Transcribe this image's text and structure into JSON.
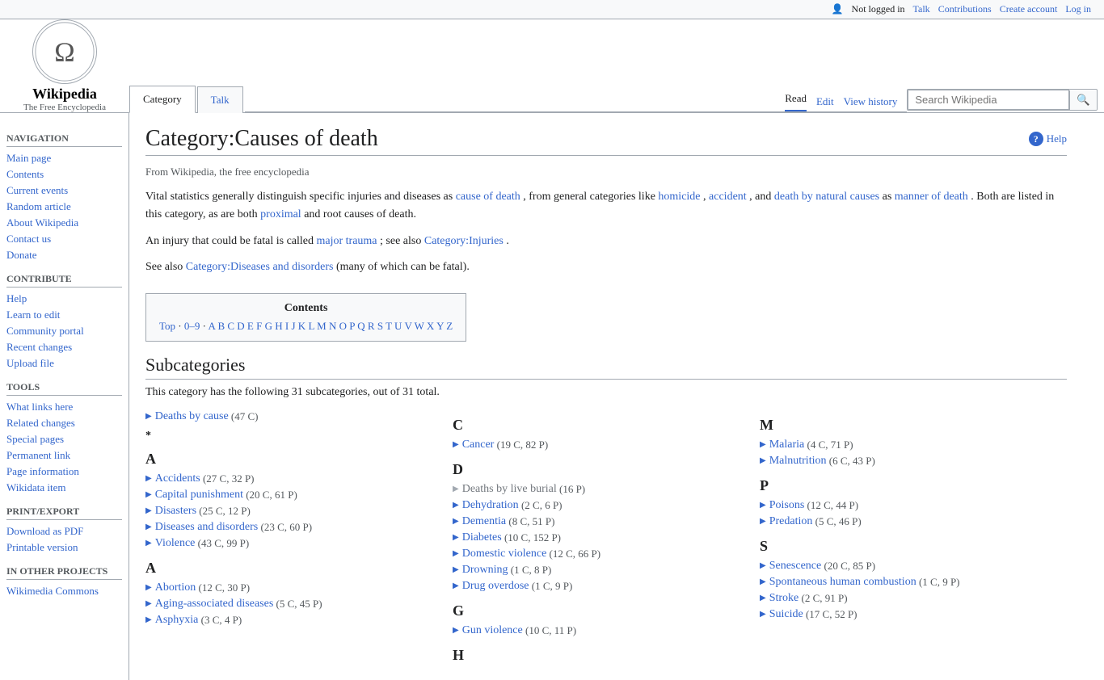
{
  "topbar": {
    "user_icon": "👤",
    "not_logged_in": "Not logged in",
    "talk": "Talk",
    "contributions": "Contributions",
    "create_account": "Create account",
    "log_in": "Log in"
  },
  "logo": {
    "title": "Wikipedia",
    "subtitle": "The Free Encyclopedia"
  },
  "tabs": {
    "category": "Category",
    "talk": "Talk"
  },
  "actions": {
    "read": "Read",
    "edit": "Edit",
    "view_history": "View history"
  },
  "search": {
    "placeholder": "Search Wikipedia"
  },
  "sidebar": {
    "navigation_title": "Navigation",
    "main_page": "Main page",
    "contents": "Contents",
    "current_events": "Current events",
    "random_article": "Random article",
    "about": "About Wikipedia",
    "contact": "Contact us",
    "donate": "Donate",
    "contribute_title": "Contribute",
    "help": "Help",
    "learn_to_edit": "Learn to edit",
    "community_portal": "Community portal",
    "recent_changes": "Recent changes",
    "upload_file": "Upload file",
    "tools_title": "Tools",
    "what_links": "What links here",
    "related_changes": "Related changes",
    "special_pages": "Special pages",
    "permanent_link": "Permanent link",
    "page_information": "Page information",
    "wikidata": "Wikidata item",
    "print_title": "Print/export",
    "download_pdf": "Download as PDF",
    "printable": "Printable version",
    "other_title": "In other projects",
    "wikimedia": "Wikimedia Commons"
  },
  "page": {
    "title": "Category:Causes of death",
    "help": "Help",
    "from_wikipedia": "From Wikipedia, the free encyclopedia",
    "para1_before": "Vital statistics generally distinguish specific injuries and diseases as ",
    "para1_link1": "cause of death",
    "para1_mid1": ", from general categories like ",
    "para1_link2": "homicide",
    "para1_sep1": ", ",
    "para1_link3": "accident",
    "para1_mid2": ", and ",
    "para1_link4": "death by natural causes",
    "para1_mid3": " as ",
    "para1_link5": "manner of death",
    "para1_end": ". Both are listed in this category, as are both ",
    "para1_link6": "proximal",
    "para1_end2": " and root causes of death.",
    "para2_before": "An injury that could be fatal is called ",
    "para2_link1": "major trauma",
    "para2_mid": "; see also ",
    "para2_link2": "Category:Injuries",
    "para2_end": ".",
    "para3_before": "See also ",
    "para3_link1": "Category:Diseases and disorders",
    "para3_end": " (many of which can be fatal).",
    "contents_title": "Contents",
    "contents_links": "Top · 0–9 · A B C D E F G H I J K L M N O P Q R S T U V W X Y Z",
    "subcategories_title": "Subcategories",
    "subcategory_desc": "This category has the following 31 subcategories, out of 31 total."
  },
  "col1": {
    "items": [
      {
        "letter": "",
        "name": "Deaths by cause",
        "count": "(47 C)",
        "gray": false,
        "special": true
      },
      {
        "letter": "*",
        "name": "",
        "count": "",
        "gray": false,
        "special": false
      },
      {
        "letter": "A",
        "name": "",
        "count": "",
        "gray": false,
        "special": false
      },
      {
        "name": "Accidents",
        "count": "(27 C, 32 P)",
        "gray": false
      },
      {
        "name": "Capital punishment",
        "count": "(20 C, 61 P)",
        "gray": false
      },
      {
        "name": "Disasters",
        "count": "(25 C, 12 P)",
        "gray": false
      },
      {
        "name": "Diseases and disorders",
        "count": "(23 C, 60 P)",
        "gray": false
      },
      {
        "name": "Violence",
        "count": "(43 C, 99 P)",
        "gray": false
      },
      {
        "letter2": "A",
        "items": [
          {
            "name": "Abortion",
            "count": "(12 C, 30 P)"
          },
          {
            "name": "Aging-associated diseases",
            "count": "(5 C, 45 P)"
          },
          {
            "name": "Asphyxia",
            "count": "(3 C, 4 P)"
          }
        ]
      }
    ]
  },
  "subcategories": {
    "col1_top": [
      {
        "type": "single",
        "name": "Deaths by cause",
        "count": "(47 C)",
        "gray": false
      }
    ],
    "col1_star": "*",
    "col1_A_label": "A",
    "col1_A_items": [
      {
        "name": "Accidents",
        "count": "(27 C, 32 P)",
        "gray": false
      },
      {
        "name": "Capital punishment",
        "count": "(20 C, 61 P)",
        "gray": false
      },
      {
        "name": "Disasters",
        "count": "(25 C, 12 P)",
        "gray": false
      },
      {
        "name": "Diseases and disorders",
        "count": "(23 C, 60 P)",
        "gray": false
      },
      {
        "name": "Violence",
        "count": "(43 C, 99 P)",
        "gray": false
      }
    ],
    "col1_A2_label": "A",
    "col1_A2_items": [
      {
        "name": "Abortion",
        "count": "(12 C, 30 P)",
        "gray": false
      },
      {
        "name": "Aging-associated diseases",
        "count": "(5 C, 45 P)",
        "gray": false
      },
      {
        "name": "Asphyxia",
        "count": "(3 C, 4 P)",
        "gray": false
      }
    ],
    "col2_C_label": "C",
    "col2_C_items": [
      {
        "name": "Cancer",
        "count": "(19 C, 82 P)",
        "gray": false
      }
    ],
    "col2_D_label": "D",
    "col2_D_items": [
      {
        "name": "Deaths by live burial",
        "count": "(16 P)",
        "gray": true
      },
      {
        "name": "Dehydration",
        "count": "(2 C, 6 P)",
        "gray": false
      },
      {
        "name": "Dementia",
        "count": "(8 C, 51 P)",
        "gray": false
      },
      {
        "name": "Diabetes",
        "count": "(10 C, 152 P)",
        "gray": false
      },
      {
        "name": "Domestic violence",
        "count": "(12 C, 66 P)",
        "gray": false
      },
      {
        "name": "Drowning",
        "count": "(1 C, 8 P)",
        "gray": false
      },
      {
        "name": "Drug overdose",
        "count": "(1 C, 9 P)",
        "gray": false
      }
    ],
    "col2_G_label": "G",
    "col2_G_items": [
      {
        "name": "Gun violence",
        "count": "(10 C, 11 P)",
        "gray": false
      }
    ],
    "col2_H_label": "H",
    "col3_M_label": "M",
    "col3_M_items": [
      {
        "name": "Malaria",
        "count": "(4 C, 71 P)",
        "gray": false
      },
      {
        "name": "Malnutrition",
        "count": "(6 C, 43 P)",
        "gray": false
      }
    ],
    "col3_P_label": "P",
    "col3_P_items": [
      {
        "name": "Poisons",
        "count": "(12 C, 44 P)",
        "gray": false
      },
      {
        "name": "Predation",
        "count": "(5 C, 46 P)",
        "gray": false
      }
    ],
    "col3_S_label": "S",
    "col3_S_items": [
      {
        "name": "Senescence",
        "count": "(20 C, 85 P)",
        "gray": false
      },
      {
        "name": "Spontaneous human combustion",
        "count": "(1 C, 9 P)",
        "gray": false
      },
      {
        "name": "Stroke",
        "count": "(2 C, 91 P)",
        "gray": false
      },
      {
        "name": "Suicide",
        "count": "(17 C, 52 P)",
        "gray": false
      }
    ]
  }
}
